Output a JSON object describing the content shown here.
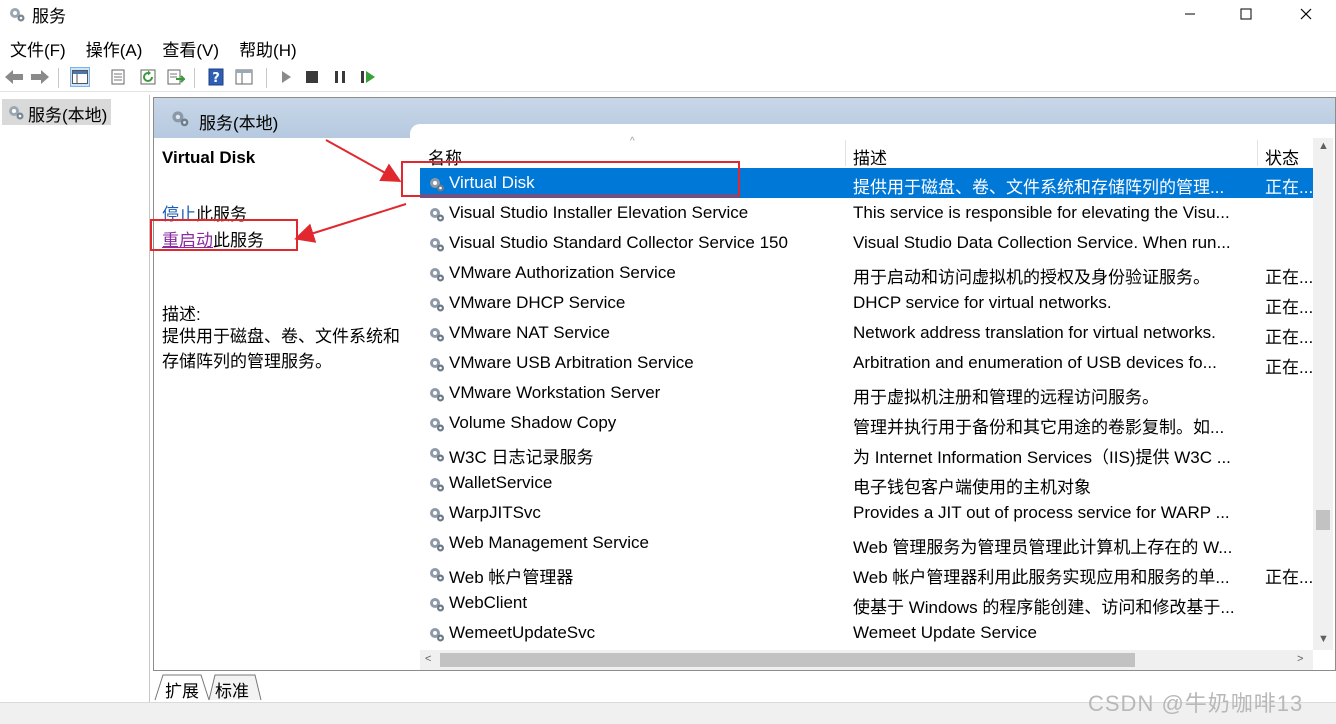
{
  "window": {
    "title": "服务",
    "icon": "gear-services-icon",
    "controls": [
      "minimize-icon",
      "maximize-icon",
      "close-icon"
    ]
  },
  "menu": [
    "文件(F)",
    "操作(A)",
    "查看(V)",
    "帮助(H)"
  ],
  "toolbar": [
    "back-arrow-icon",
    "forward-arrow-icon",
    "show-hide-tree-icon",
    "properties-icon",
    "refresh-icon",
    "export-list-icon",
    "help-icon",
    "view-icon",
    "start-service-icon",
    "stop-service-icon",
    "pause-service-icon",
    "resume-service-icon"
  ],
  "tree": {
    "root_label": "服务(本地)"
  },
  "panel": {
    "header_title": "服务(本地)",
    "selected_service": "Virtual Disk",
    "stop_link": "停止",
    "stop_suffix": "此服务",
    "restart_link": "重启动",
    "restart_suffix": "此服务",
    "description_label": "描述:",
    "description_text": "提供用于磁盘、卷、文件系统和存储阵列的管理服务。"
  },
  "columns": {
    "name": "名称",
    "description": "描述",
    "status": "状态"
  },
  "rows": [
    {
      "name": "Virtual Disk",
      "description": "提供用于磁盘、卷、文件系统和存储阵列的管理...",
      "status": "正在...",
      "selected": true
    },
    {
      "name": "Visual Studio Installer Elevation Service",
      "description": "This service is responsible for elevating the Visu...",
      "status": ""
    },
    {
      "name": "Visual Studio Standard Collector Service 150",
      "description": "Visual Studio Data Collection Service. When run...",
      "status": ""
    },
    {
      "name": "VMware Authorization Service",
      "description": "用于启动和访问虚拟机的授权及身份验证服务。",
      "status": "正在..."
    },
    {
      "name": "VMware DHCP Service",
      "description": "DHCP service for virtual networks.",
      "status": "正在..."
    },
    {
      "name": "VMware NAT Service",
      "description": "Network address translation for virtual networks.",
      "status": "正在..."
    },
    {
      "name": "VMware USB Arbitration Service",
      "description": "Arbitration and enumeration of USB devices fo...",
      "status": "正在..."
    },
    {
      "name": "VMware Workstation Server",
      "description": "用于虚拟机注册和管理的远程访问服务。",
      "status": ""
    },
    {
      "name": "Volume Shadow Copy",
      "description": "管理并执行用于备份和其它用途的卷影复制。如...",
      "status": ""
    },
    {
      "name": "W3C 日志记录服务",
      "description": "为 Internet Information Services（IIS)提供 W3C ...",
      "status": ""
    },
    {
      "name": "WalletService",
      "description": "电子钱包客户端使用的主机对象",
      "status": ""
    },
    {
      "name": "WarpJITSvc",
      "description": "Provides a JIT out of process service for WARP ...",
      "status": ""
    },
    {
      "name": "Web Management Service",
      "description": "Web 管理服务为管理员管理此计算机上存在的 W...",
      "status": ""
    },
    {
      "name": "Web 帐户管理器",
      "description": "Web 帐户管理器利用此服务实现应用和服务的单...",
      "status": "正在..."
    },
    {
      "name": "WebClient",
      "description": "使基于 Windows 的程序能创建、访问和修改基于...",
      "status": ""
    },
    {
      "name": "WemeetUpdateSvc",
      "description": "Wemeet Update Service",
      "status": ""
    }
  ],
  "tabs": [
    "扩展",
    "标准"
  ],
  "watermark": "CSDN @牛奶咖啡13",
  "colors": {
    "selection": "#0078d7",
    "annotation": "#e0282e",
    "link": "#1a5fb4",
    "visited_link": "#8a2aa0"
  }
}
